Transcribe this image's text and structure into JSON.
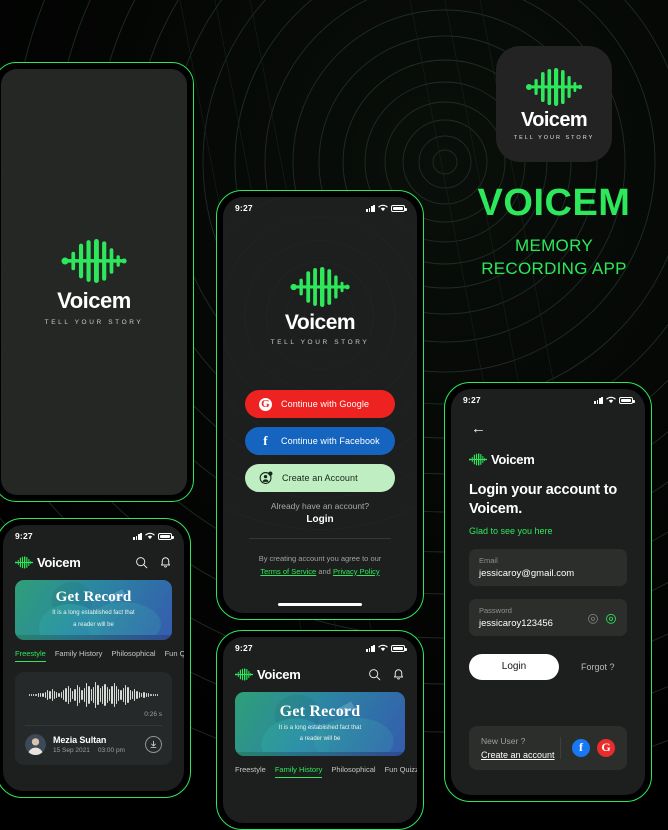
{
  "brand": {
    "name": "Voicem",
    "tagline": "TELL YOUR STORY",
    "hero_name": "VOICEM",
    "hero_sub_line1": "MEMORY",
    "hero_sub_line2": "RECORDING APP",
    "accent": "#2ee85c",
    "bg": "#000000",
    "screen_bg": "#1c1f1d"
  },
  "status_bar": {
    "time": "9:27",
    "signal_icon": "signal-bars-icon",
    "wifi_icon": "wifi-icon",
    "battery_icon": "battery-icon"
  },
  "auth_screen": {
    "logo_name": "Voicem",
    "logo_tagline": "TELL YOUR STORY",
    "buttons": [
      {
        "id": "google",
        "label": "Continue with Google",
        "icon": "google-g-icon",
        "bg": "#ef2222"
      },
      {
        "id": "facebook",
        "label": "Continue with Facebook",
        "icon": "facebook-f-icon",
        "bg": "#1464c0"
      },
      {
        "id": "create",
        "label": "Create an Account",
        "icon": "add-user-icon",
        "bg": "#bfeec2"
      }
    ],
    "have_account": "Already have an account?",
    "login_link": "Login",
    "legal_prefix": "By creating account you agree to our",
    "terms_link": "Terms of Service",
    "legal_and": "and",
    "privacy_link": "Privacy Policy"
  },
  "login_screen": {
    "back_icon": "back-arrow-icon",
    "logo_name": "Voicem",
    "title": "Login your account to Voicem.",
    "subtitle": "Glad to see you here",
    "email_label": "Email",
    "email_value": "jessicaroy@gmail.com",
    "password_label": "Password",
    "password_value": "jessicaroy123456",
    "eye_off_icon": "eye-off-icon",
    "eye_on_icon": "eye-on-icon",
    "login_button": "Login",
    "forgot": "Forgot ?",
    "new_user_question": "New User ?",
    "create_account_link": "Create an account",
    "social_facebook": "f",
    "social_google": "G"
  },
  "home_screen": {
    "logo_name": "Voicem",
    "search_icon": "search-icon",
    "bell_icon": "bell-icon",
    "banner_title": "Get Record",
    "banner_sub_line1": "It is a long established fact that",
    "banner_sub_line2": "a reader will be",
    "tabs": [
      "Freestyle",
      "Family History",
      "Philosophical",
      "Fun Quizzes"
    ],
    "active_tab_primary": "Freestyle",
    "active_tab_secondary": "Family History",
    "recording": {
      "duration": "0:26 s",
      "name": "Mezia Sultan",
      "date": "15 Sep 2021",
      "time": "03:00 pm",
      "download_icon": "download-icon",
      "avatar": "user-avatar"
    }
  }
}
